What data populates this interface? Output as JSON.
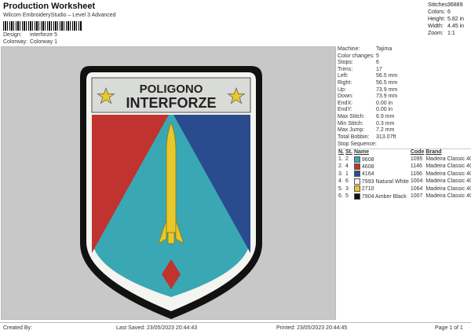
{
  "header": {
    "title": "Production Worksheet",
    "subtitle": "Wilcom EmbroideryStudio – Level 3 Advanced",
    "design_label": "Design:",
    "design_value": "interforze 5",
    "colorway_label": "Colorway:",
    "colorway_value": "Colorway 1"
  },
  "summary": [
    {
      "k": "Stitches:",
      "v": "36889"
    },
    {
      "k": "Colors:",
      "v": "6"
    },
    {
      "k": "Height:",
      "v": "5.82 in"
    },
    {
      "k": "Width:",
      "v": "4.45 in"
    },
    {
      "k": "Zoom:",
      "v": "1:1"
    }
  ],
  "details": [
    {
      "k": "Machine:",
      "v": "Tajima"
    },
    {
      "k": "Color changes:",
      "v": "5"
    },
    {
      "k": "Stops:",
      "v": "6"
    },
    {
      "k": "Trims:",
      "v": "17"
    },
    {
      "k": "Left:",
      "v": "56.5 mm"
    },
    {
      "k": "Right:",
      "v": "56.5 mm"
    },
    {
      "k": "Up:",
      "v": "73.9 mm"
    },
    {
      "k": "Down:",
      "v": "73.9 mm"
    },
    {
      "k": "EndX:",
      "v": "0.00 in"
    },
    {
      "k": "EndY:",
      "v": "0.00 in"
    },
    {
      "k": "Max Stitch:",
      "v": "6.9 mm"
    },
    {
      "k": "Min Stitch:",
      "v": "0.3 mm"
    },
    {
      "k": "Max Jump:",
      "v": "7.2 mm"
    },
    {
      "k": "Total Bobbin:",
      "v": "313.07ft"
    }
  ],
  "sequence": {
    "label": "Stop Sequence:",
    "columns": [
      "N.",
      "St.",
      "Name",
      "Code",
      "Brand"
    ],
    "rows": [
      {
        "n": "1.",
        "st": "2",
        "color": "#3aa7b5",
        "num": "9608",
        "name": "",
        "code": "1095",
        "brand": "Madeira Classic 40"
      },
      {
        "n": "2.",
        "st": "4",
        "color": "#c0332e",
        "num": "4608",
        "name": "",
        "code": "1146",
        "brand": "Madeira Classic 40"
      },
      {
        "n": "3.",
        "st": "1",
        "color": "#2a4b8d",
        "num": "4164",
        "name": "",
        "code": "1166",
        "brand": "Madeira Classic 40"
      },
      {
        "n": "4.",
        "st": "6",
        "color": "#f2f2ee",
        "num": "7993",
        "name": "Natural White",
        "code": "1004",
        "brand": "Madeira Classic 40"
      },
      {
        "n": "5.",
        "st": "3",
        "color": "#e8c82a",
        "num": "2710",
        "name": "",
        "code": "1064",
        "brand": "Madeira Classic 40"
      },
      {
        "n": "6.",
        "st": "5",
        "color": "#111111",
        "num": "7904",
        "name": "Amber Black",
        "code": "1007",
        "brand": "Madeira Classic 40"
      }
    ]
  },
  "patch": {
    "line1": "POLIGONO",
    "line2": "INTERFORZE"
  },
  "footer": {
    "created": "Created By:",
    "saved": "Last Saved: 23/05/2023 20:44:43",
    "printed": "Printed: 23/05/2023 20:44:45",
    "page": "Page 1 of 1"
  }
}
